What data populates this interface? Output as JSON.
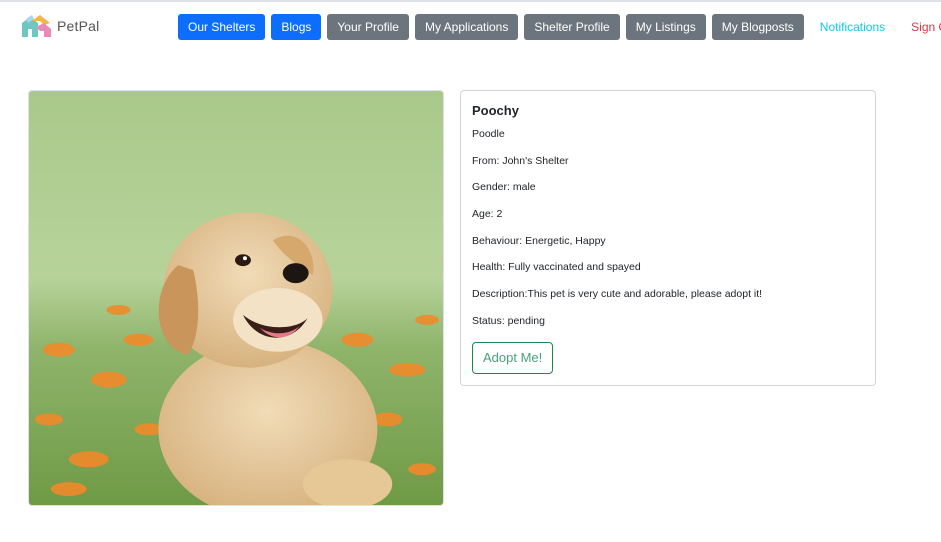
{
  "header": {
    "brand_name": "PetPal",
    "nav": [
      {
        "label": "Our Shelters",
        "style": "primary"
      },
      {
        "label": "Blogs",
        "style": "primary"
      },
      {
        "label": "Your Profile",
        "style": "secondary"
      },
      {
        "label": "My Applications",
        "style": "secondary"
      },
      {
        "label": "Shelter Profile",
        "style": "secondary"
      },
      {
        "label": "My Listings",
        "style": "secondary"
      },
      {
        "label": "My Blogposts",
        "style": "secondary"
      },
      {
        "label": "Notifications",
        "style": "outline-info"
      },
      {
        "label": "Sign Out",
        "style": "outline-danger"
      }
    ]
  },
  "pet": {
    "name": "Poochy",
    "breed": "Poodle",
    "from": "From: John's Shelter",
    "gender": "Gender: male",
    "age": "Age: 2",
    "behaviour": "Behaviour: Energetic, Happy",
    "health": "Health: Fully vaccinated and spayed",
    "description": "Description:This pet is very cute and adorable, please adopt it!",
    "status": "Status: pending",
    "adopt_label": "Adopt Me!"
  },
  "colors": {
    "primary": "#0d6efd",
    "secondary": "#6c757d",
    "info": "#0dcaf0",
    "danger": "#dc3545",
    "success": "#198754"
  }
}
